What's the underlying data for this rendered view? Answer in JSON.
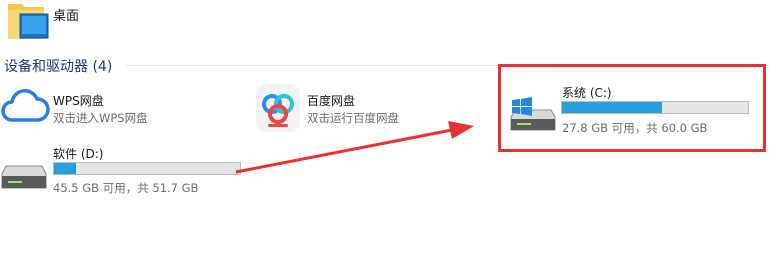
{
  "desktop": {
    "label": "桌面",
    "icon": "desktop-folder-icon"
  },
  "section": {
    "title": "设备和驱动器 (4)"
  },
  "locations": {
    "wps": {
      "title": "WPS网盘",
      "subtitle": "双击进入WPS网盘",
      "icon": "cloud-icon"
    },
    "baidu": {
      "title": "百度网盘",
      "subtitle": "双击运行百度网盘",
      "icon": "baidu-netdisk-icon"
    }
  },
  "drives": {
    "d": {
      "title": "软件 (D:)",
      "usage_text": "45.5 GB 可用，共 51.7 GB",
      "used_fraction": 0.12,
      "icon": "hard-drive-icon"
    },
    "c": {
      "title": "系统 (C:)",
      "usage_text": "27.8 GB 可用，共 60.0 GB",
      "used_fraction": 0.54,
      "icon": "system-drive-icon"
    }
  },
  "colors": {
    "accent": "#26a0da",
    "section_title": "#1e3287",
    "annotation": "#e83232"
  }
}
